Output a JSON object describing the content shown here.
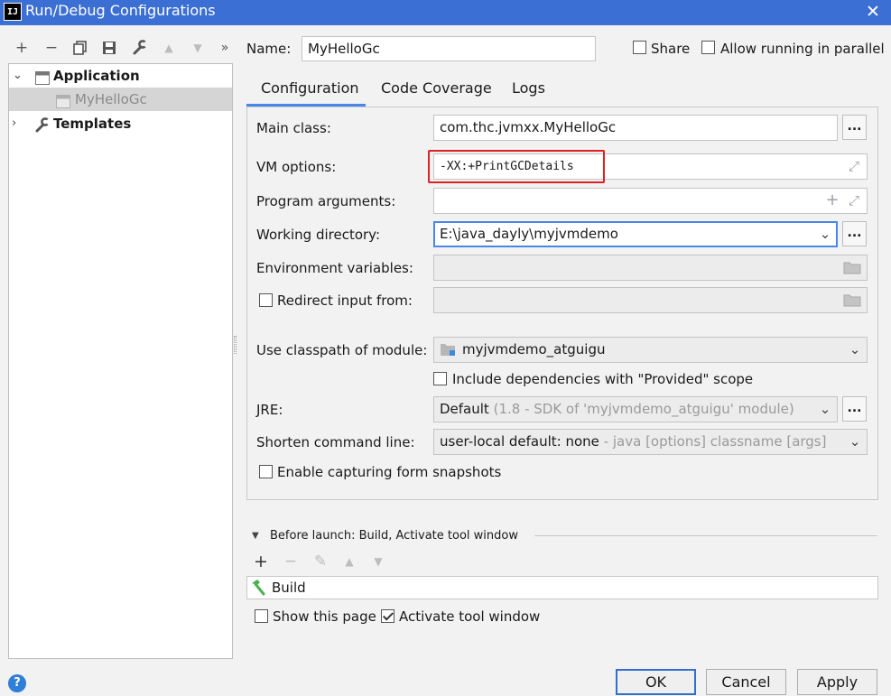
{
  "window": {
    "title": "Run/Debug Configurations",
    "app_icon": "IJ",
    "close_glyph": "✕"
  },
  "toolbar": {
    "add": "+",
    "remove": "−",
    "copy": "⧉",
    "save": "💾",
    "wrench": "🔧",
    "up": "▲",
    "down": "▼",
    "more": "»"
  },
  "tree": {
    "application_label": "Application",
    "child_label": "MyHelloGc",
    "templates_label": "Templates"
  },
  "name_row": {
    "label": "Name:",
    "value": "MyHelloGc",
    "share_label": "Share",
    "parallel_label": "Allow running in parallel"
  },
  "tabs": [
    "Configuration",
    "Code Coverage",
    "Logs"
  ],
  "form": {
    "main_class_label": "Main class:",
    "main_class_value": "com.thc.jvmxx.MyHelloGc",
    "vm_options_label": "VM options:",
    "vm_options_value": "-XX:+PrintGCDetails",
    "program_args_label": "Program arguments:",
    "program_args_value": "",
    "working_dir_label": "Working directory:",
    "working_dir_value": "E:\\java_dayly\\myjvmdemo",
    "env_vars_label": "Environment variables:",
    "env_vars_value": "",
    "redirect_label": "Redirect input from:",
    "classpath_label": "Use classpath of module:",
    "classpath_value": "myjvmdemo_atguigu",
    "include_deps_label": "Include dependencies with \"Provided\" scope",
    "jre_label": "JRE:",
    "jre_value": "Default",
    "jre_hint": "(1.8 - SDK of 'myjvmdemo_atguigu' module)",
    "shorten_label": "Shorten command line:",
    "shorten_value": "user-local default: none",
    "shorten_hint": "- java [options] classname [args]",
    "snapshots_label": "Enable capturing form snapshots",
    "dots": "..."
  },
  "before_launch": {
    "title": "Before launch: Build, Activate tool window",
    "task": "Build",
    "show_page_label": "Show this page",
    "activate_label": "Activate tool window"
  },
  "buttons": {
    "ok": "OK",
    "cancel": "Cancel",
    "apply": "Apply",
    "help": "?"
  },
  "colors": {
    "titlebar": "#3b6fd4",
    "accent": "#4a86e8",
    "highlight": "#e02020"
  }
}
